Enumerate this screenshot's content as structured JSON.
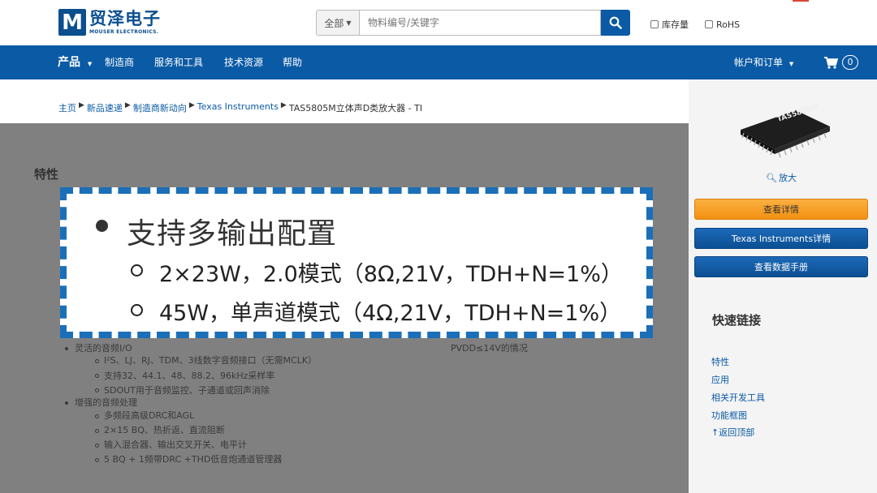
{
  "header": {
    "logo_mark": "M",
    "logo_cn": "贸泽电子",
    "logo_en": "MOUSER ELECTRONICS.",
    "search_scope": "全部",
    "search_placeholder": "物料编号/关键字",
    "check_stock": "库存量",
    "check_rohs": "RoHS"
  },
  "nav": {
    "products": "产品",
    "manufacturers": "制造商",
    "services": "服务和工具",
    "tech": "技术资源",
    "help": "帮助",
    "account": "帐户和订单",
    "cart_count": "0"
  },
  "breadcrumb": {
    "home": "主页",
    "new_fast": "新品速递",
    "mfr_news": "制造商新动向",
    "ti": "Texas Instruments",
    "current": "TAS5805M立体声D类放大器 - TI"
  },
  "main": {
    "section_title": "特性",
    "items": [
      "灵活的音频I/O",
      "I²S、LJ、RJ、TDM、3线数字音频接口（无需MCLK）",
      "支持32、44.1、48、88.2、96kHz采样率",
      "SDOUT用于音频监控、子通道或回声消除",
      "增强的音频处理",
      "多频段高级DRC和AGL",
      "2×15 BQ、热折返、直流阻断",
      "输入混合器、输出交叉开关、电平计",
      "5 BQ + 1频带DRC +THD低音炮通道管理器"
    ],
    "right_note": "PVDD≤14V的情况"
  },
  "callout": {
    "line1": "支持多输出配置",
    "line2": "2×23W，2.0模式（8Ω,21V，TDH+N=1%）",
    "line3": "45W，单声道模式（4Ω,21V，TDH+N=1%）"
  },
  "sidebar": {
    "chip_label": "TAS5805M",
    "zoom": "放大",
    "btn_details": "查看详情",
    "btn_ti": "Texas Instruments详情",
    "btn_datasheet": "查看数据手册",
    "quick_links_title": "快速链接",
    "links": [
      "特性",
      "应用",
      "相关开发工具",
      "功能框图",
      "返回顶部"
    ]
  },
  "colors": {
    "brand_blue": "#0b5aa5",
    "orange_button": "#f29111",
    "callout_border": "#1a6fb8"
  }
}
